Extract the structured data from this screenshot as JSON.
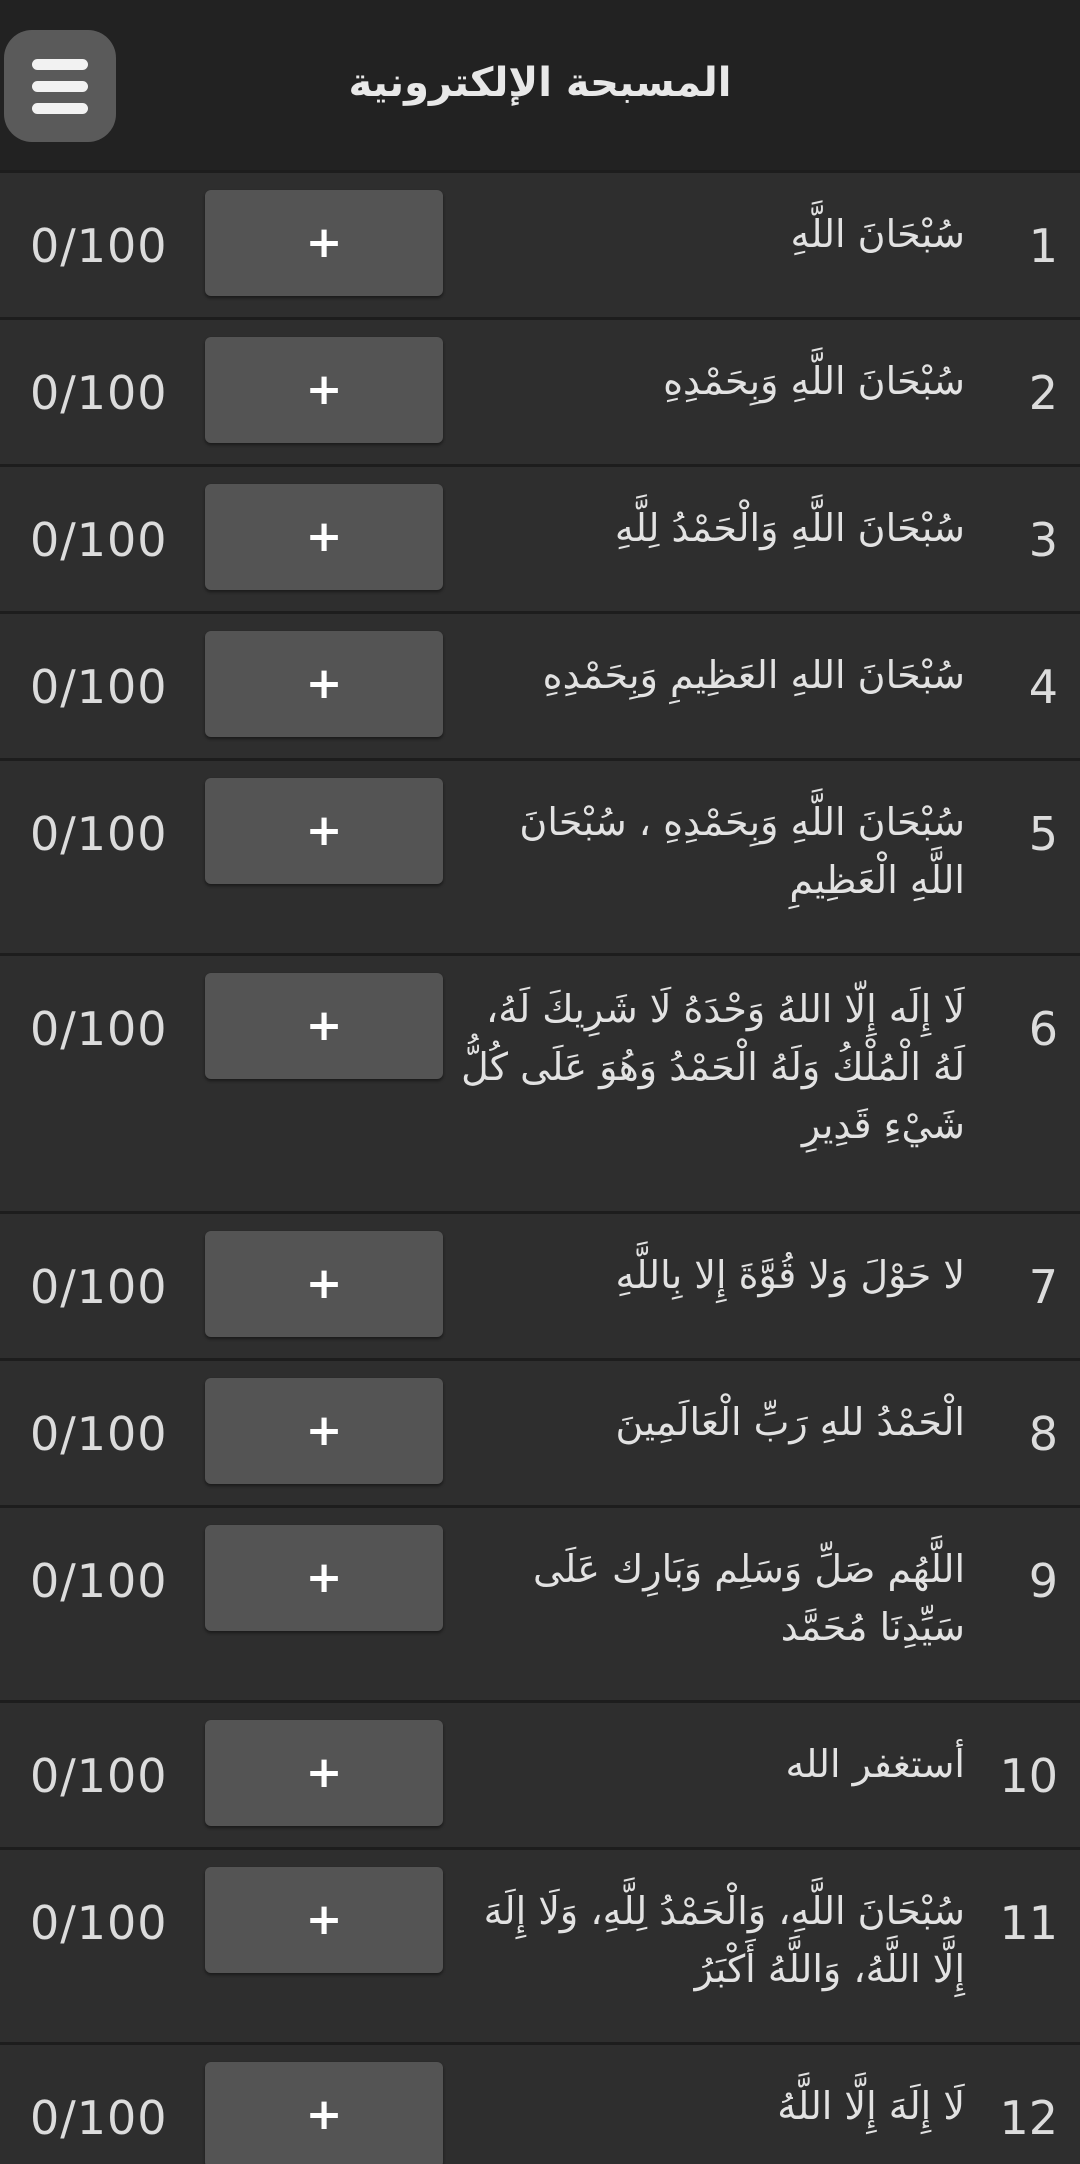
{
  "header": {
    "title": "المسبحة الإلكترونية",
    "menu_icon": "hamburger-menu-icon"
  },
  "colors": {
    "header_bg": "#222222",
    "list_bg": "#2e2e2e",
    "button_bg": "#545454",
    "divider": "#1d1d1d",
    "text": "#e2e2e2"
  },
  "items": [
    {
      "number": "1",
      "text": "سُبْحَانَ اللَّهِ",
      "count": "0/100",
      "button": "+"
    },
    {
      "number": "2",
      "text": "سُبْحَانَ اللَّهِ وَبِحَمْدِهِ",
      "count": "0/100",
      "button": "+"
    },
    {
      "number": "3",
      "text": "سُبْحَانَ اللَّهِ وَالْحَمْدُ لِلَّهِ",
      "count": "0/100",
      "button": "+"
    },
    {
      "number": "4",
      "text": "سُبْحَانَ اللهِ العَظِيمِ وَبِحَمْدِهِ",
      "count": "0/100",
      "button": "+"
    },
    {
      "number": "5",
      "text": "سُبْحَانَ اللَّهِ وَبِحَمْدِهِ ، سُبْحَانَ اللَّهِ الْعَظِيمِ",
      "count": "0/100",
      "button": "+"
    },
    {
      "number": "6",
      "text": "لَا إِلَه إِلّا اللهُ وَحْدَهُ لَا شَرِيكَ لَهُ، لَهُ الْمُلْكُ وَلَهُ الْحَمْدُ وَهُوَ عَلَى كُلُّ شَيْءِ قَدِيرِ",
      "count": "0/100",
      "button": "+"
    },
    {
      "number": "7",
      "text": "لا حَوْلَ وَلا قُوَّةَ إِلا بِاللَّهِ",
      "count": "0/100",
      "button": "+"
    },
    {
      "number": "8",
      "text": "الْحَمْدُ للهِ رَبِّ الْعَالَمِينَ",
      "count": "0/100",
      "button": "+"
    },
    {
      "number": "9",
      "text": "اللَّهُم صَلِّ وَسَلِم وَبَارِك عَلَى سَيِّدِنَا مُحَمَّد",
      "count": "0/100",
      "button": "+"
    },
    {
      "number": "10",
      "text": "أستغفر الله",
      "count": "0/100",
      "button": "+"
    },
    {
      "number": "11",
      "text": "سُبْحَانَ اللَّهِ، وَالْحَمْدُ لِلَّهِ، وَلَا إِلَهَ إِلَّا اللَّهُ، وَاللَّهُ أَكْبَرُ",
      "count": "0/100",
      "button": "+"
    },
    {
      "number": "12",
      "text": "لَا إِلَهَ إِلَّا اللَّهُ",
      "count": "0/100",
      "button": "+"
    }
  ]
}
